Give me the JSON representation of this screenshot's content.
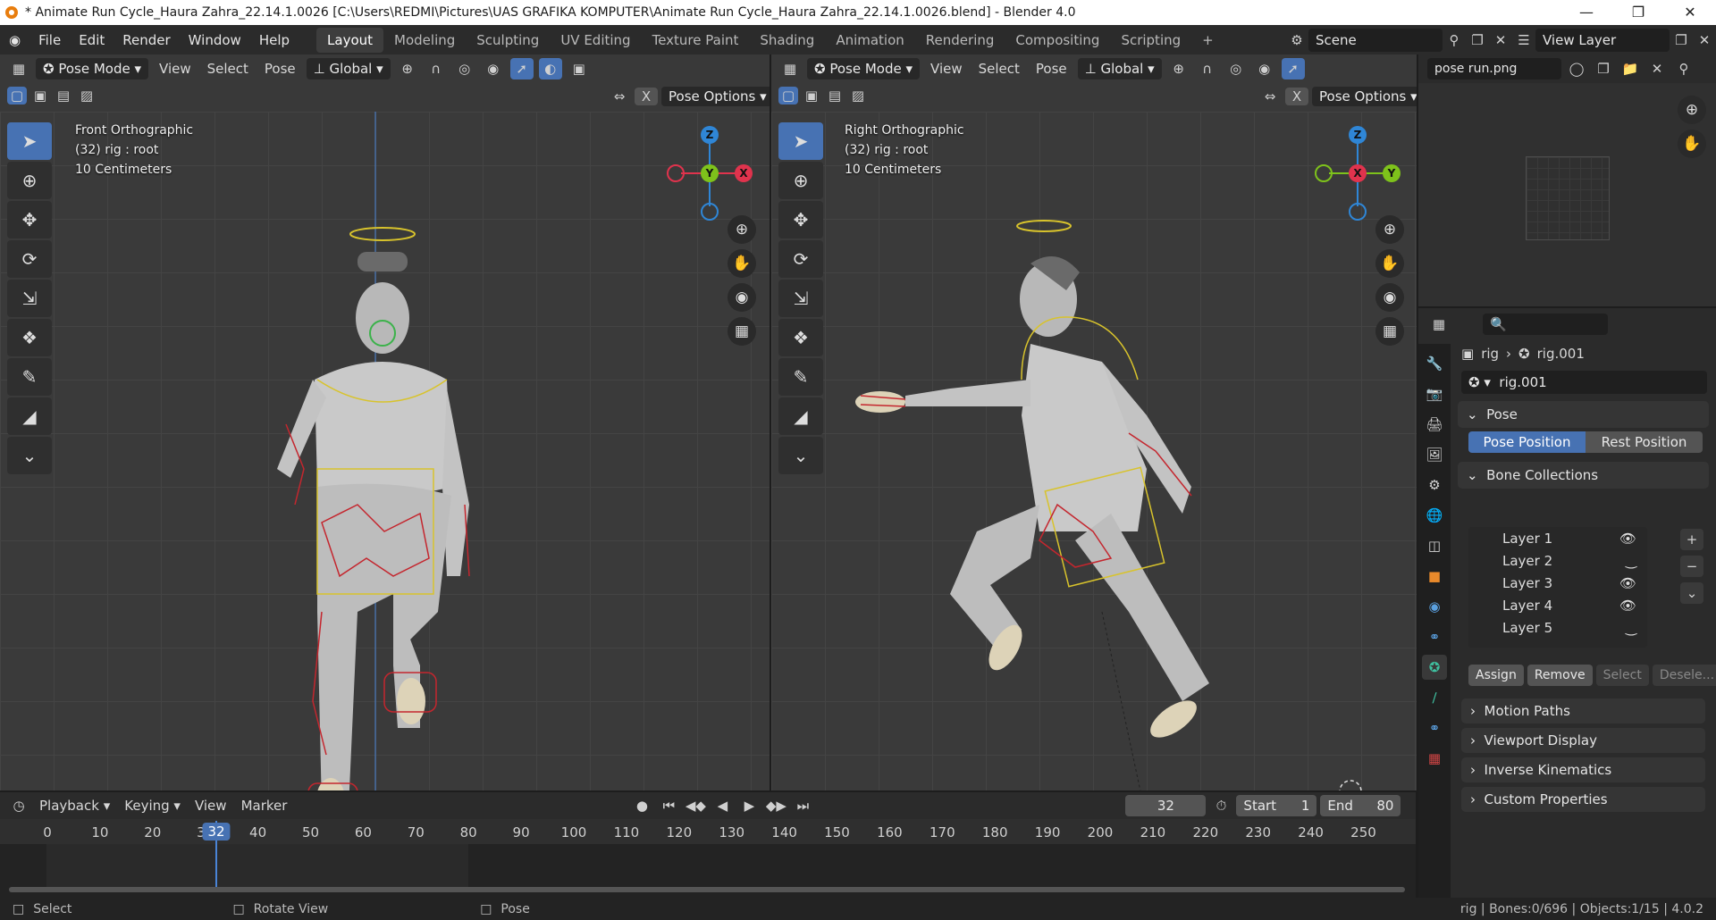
{
  "window": {
    "title": "* Animate Run Cycle_Haura Zahra_22.14.1.0026 [C:\\Users\\REDMI\\Pictures\\UAS GRAFIKA KOMPUTER\\Animate Run Cycle_Haura Zahra_22.14.1.0026.blend] - Blender 4.0",
    "controls": [
      "—",
      "❐",
      "✕"
    ]
  },
  "menu": {
    "items": [
      "File",
      "Edit",
      "Render",
      "Window",
      "Help"
    ],
    "workspaces": [
      "Layout",
      "Modeling",
      "Sculpting",
      "UV Editing",
      "Texture Paint",
      "Shading",
      "Animation",
      "Rendering",
      "Compositing",
      "Scripting",
      "+"
    ],
    "active_workspace": "Layout",
    "scene": "Scene",
    "view_layer": "View Layer"
  },
  "viewport_left": {
    "mode": "Pose Mode",
    "menus": [
      "View",
      "Select",
      "Pose"
    ],
    "orientation": "Global",
    "pose_options": "Pose Options",
    "x_label": "X",
    "view_name": "Front Orthographic",
    "object_info": "(32) rig : root",
    "scale": "10 Centimeters",
    "gizmo": {
      "top": "Z",
      "center": "Y",
      "right": "X"
    }
  },
  "viewport_right": {
    "mode": "Pose Mode",
    "menus": [
      "View",
      "Select",
      "Pose"
    ],
    "orientation": "Global",
    "pose_options": "Pose Options",
    "x_label": "X",
    "view_name": "Right Orthographic",
    "object_info": "(32) rig : root",
    "scale": "10 Centimeters",
    "gizmo": {
      "top": "Z",
      "center": "X",
      "right": "Y"
    }
  },
  "image_editor": {
    "image_name": "pose run.png"
  },
  "properties": {
    "breadcrumb_object": "rig",
    "breadcrumb_data": "rig.001",
    "armature_name": "rig.001",
    "pose_section": "Pose",
    "pose_position": "Pose Position",
    "rest_position": "Rest Position",
    "bone_collections": "Bone Collections",
    "layers": [
      {
        "name": "Layer 1",
        "visible": true
      },
      {
        "name": "Layer 2",
        "visible": false
      },
      {
        "name": "Layer 3",
        "visible": true
      },
      {
        "name": "Layer 4",
        "visible": true
      },
      {
        "name": "Layer 5",
        "visible": false
      }
    ],
    "assign": "Assign",
    "remove": "Remove",
    "select": "Select",
    "deselect": "Desele...",
    "sections": [
      "Motion Paths",
      "Viewport Display",
      "Inverse Kinematics",
      "Custom Properties"
    ]
  },
  "timeline": {
    "menus": [
      "Playback",
      "Keying",
      "View",
      "Marker"
    ],
    "current_frame": "32",
    "start_label": "Start",
    "start": "1",
    "end_label": "End",
    "end": "80",
    "ticks": [
      "0",
      "10",
      "20",
      "30",
      "40",
      "50",
      "60",
      "70",
      "80",
      "90",
      "100",
      "110",
      "120",
      "130",
      "140",
      "150",
      "160",
      "170",
      "180",
      "190",
      "200",
      "210",
      "220",
      "230",
      "240",
      "250"
    ]
  },
  "statusbar": {
    "select": "Select",
    "rotate": "Rotate View",
    "pose": "Pose",
    "info": "rig | Bones:0/696 | Objects:1/15 | 4.0.2"
  },
  "colors": {
    "accent": "#4772b3",
    "axis_x": "#e0334d",
    "axis_y": "#7ec21b",
    "axis_z": "#2f86d6"
  }
}
